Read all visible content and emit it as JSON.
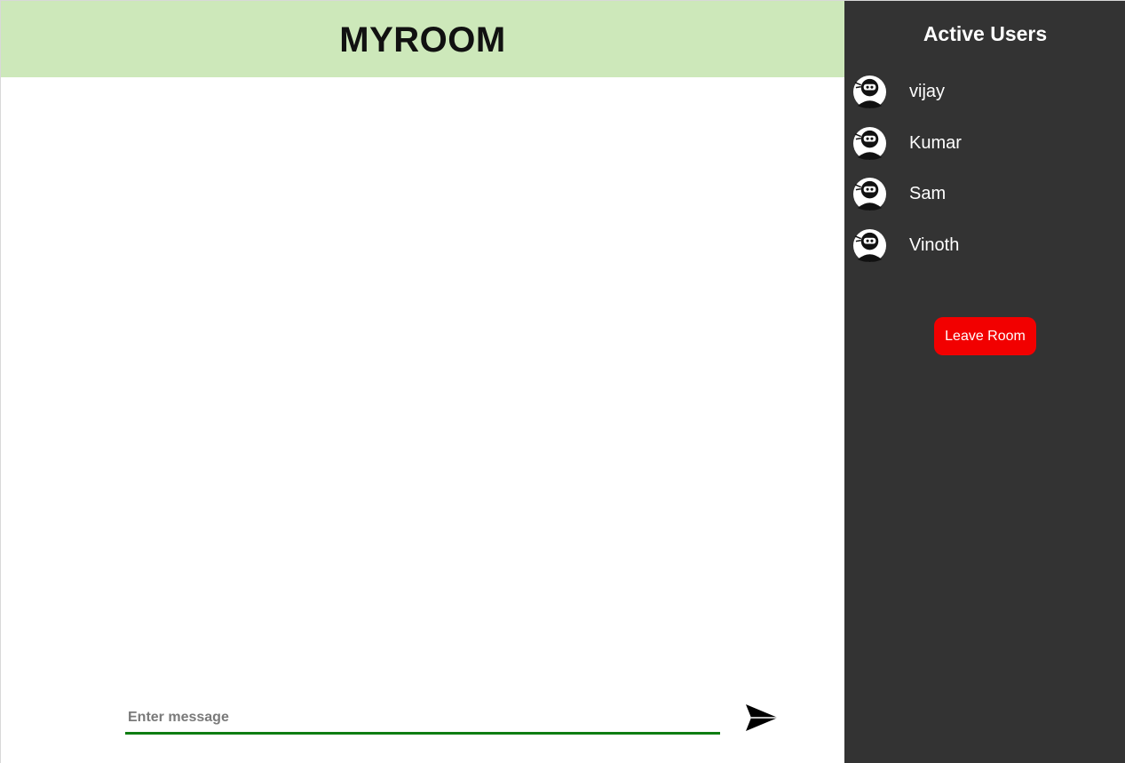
{
  "chat": {
    "room_title": "MYROOM",
    "input": {
      "placeholder": "Enter message",
      "value": ""
    },
    "send_icon": "send-arrow-icon",
    "accent_color": "#0f7d12",
    "header_color": "#cde8ba"
  },
  "sidebar": {
    "title": "Active Users",
    "users": [
      {
        "name": "vijay",
        "icon": "ninja-avatar-icon"
      },
      {
        "name": "Kumar",
        "icon": "ninja-avatar-icon"
      },
      {
        "name": "Sam",
        "icon": "ninja-avatar-icon"
      },
      {
        "name": "Vinoth",
        "icon": "ninja-avatar-icon"
      }
    ],
    "leave_label": "Leave Room",
    "leave_color": "#f20000",
    "background_color": "#333333"
  }
}
